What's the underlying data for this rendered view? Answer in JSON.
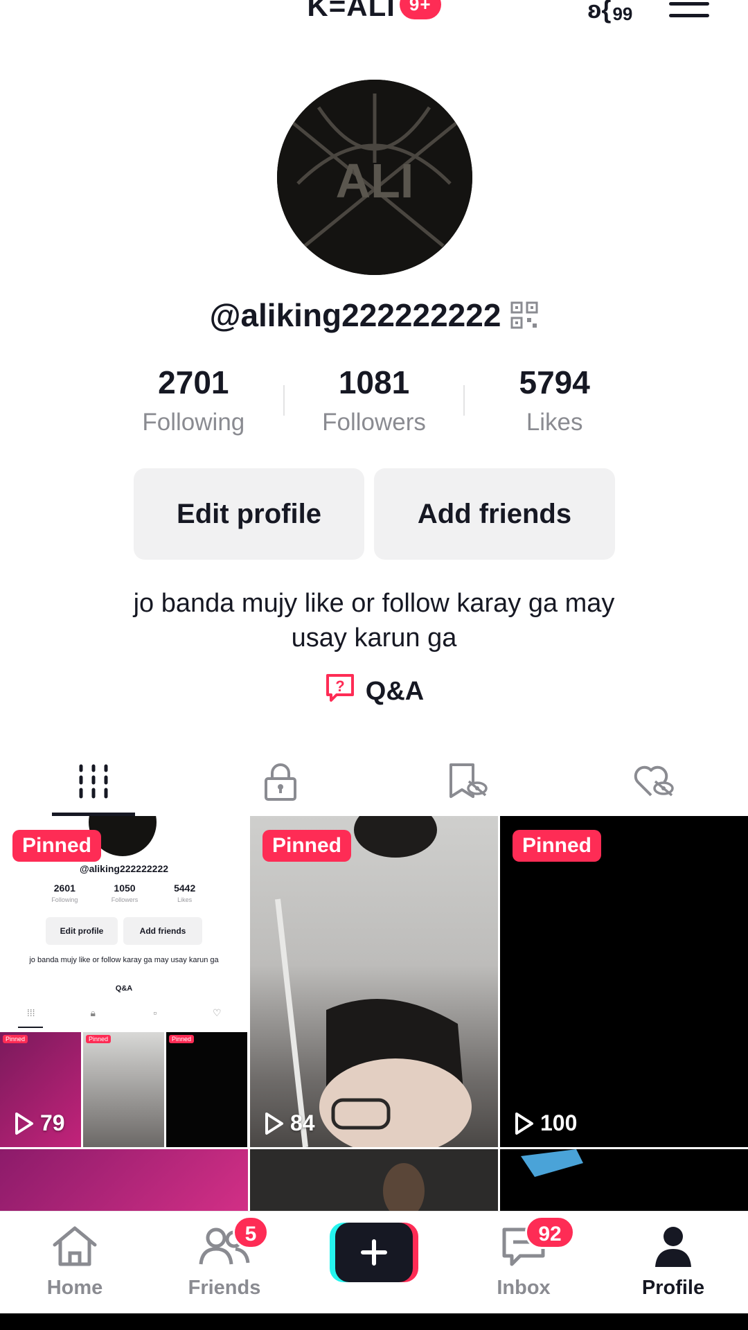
{
  "header": {
    "title": "K=ALI",
    "notification_badge": "9+",
    "creator_count": "99"
  },
  "profile": {
    "username": "@aliking222222222",
    "avatar_text": "ALI",
    "stats": [
      {
        "value": "2701",
        "label": "Following"
      },
      {
        "value": "1081",
        "label": "Followers"
      },
      {
        "value": "5794",
        "label": "Likes"
      }
    ],
    "edit_profile_label": "Edit profile",
    "add_friends_label": "Add friends",
    "bio_line1": "jo banda mujy like or follow karay ga may",
    "bio_line2": "usay karun ga",
    "qa_label": "Q&A"
  },
  "tabs": [
    {
      "icon": "grid-icon",
      "active": true
    },
    {
      "icon": "lock-icon",
      "active": false
    },
    {
      "icon": "saved-hidden-icon",
      "active": false
    },
    {
      "icon": "liked-hidden-icon",
      "active": false
    }
  ],
  "videos": [
    {
      "pinned_label": "Pinned",
      "views": "79"
    },
    {
      "pinned_label": "Pinned",
      "views": "84"
    },
    {
      "pinned_label": "Pinned",
      "views": "100"
    }
  ],
  "mini_preview": {
    "username": "@aliking222222222",
    "stats": [
      {
        "value": "2601",
        "label": "Following"
      },
      {
        "value": "1050",
        "label": "Followers"
      },
      {
        "value": "5442",
        "label": "Likes"
      }
    ],
    "edit_label": "Edit profile",
    "add_label": "Add friends",
    "bio": "jo banda mujy like or follow karay ga may usay karun ga",
    "qa": "Q&A",
    "tile_pin": "Pinned"
  },
  "bottom_nav": {
    "home": "Home",
    "friends": "Friends",
    "friends_badge": "5",
    "inbox": "Inbox",
    "inbox_badge": "92",
    "profile": "Profile"
  },
  "colors": {
    "accent": "#fe2c55",
    "cyan": "#25f4ee",
    "text": "#161823",
    "muted": "#8a8b91"
  }
}
